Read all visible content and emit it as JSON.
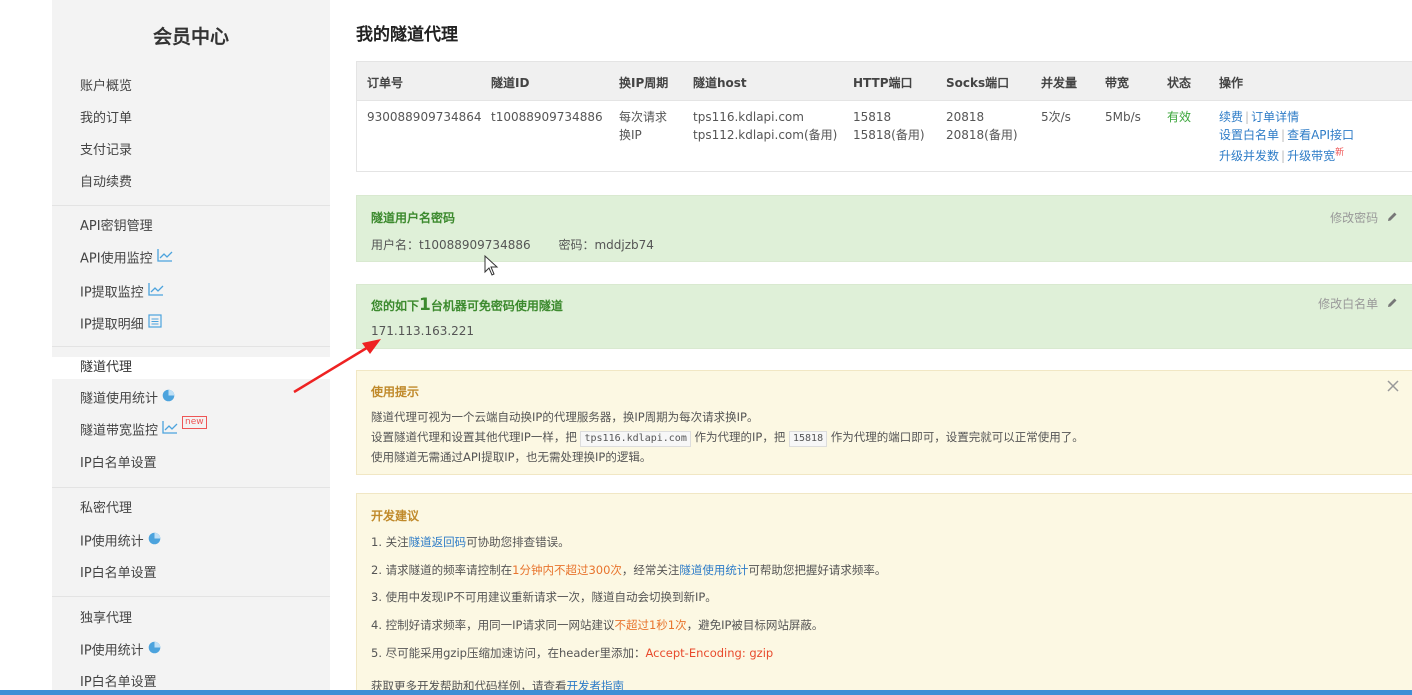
{
  "sidebar": {
    "title": "会员中心",
    "groups": [
      {
        "items": [
          {
            "label": "账户概览"
          },
          {
            "label": "我的订单"
          },
          {
            "label": "支付记录"
          },
          {
            "label": "自动续费"
          }
        ]
      },
      {
        "items": [
          {
            "label": "API密钥管理"
          },
          {
            "label": "API使用监控",
            "icon": "line-chart-icon"
          },
          {
            "label": "IP提取监控",
            "icon": "line-chart-icon"
          },
          {
            "label": "IP提取明细",
            "icon": "document-icon"
          }
        ]
      },
      {
        "items": [
          {
            "label": "隧道代理",
            "active": true
          },
          {
            "label": "隧道使用统计",
            "icon": "pie-chart-icon"
          },
          {
            "label": "隧道带宽监控",
            "icon": "line-chart-icon",
            "badge": "new"
          },
          {
            "label": "IP白名单设置"
          }
        ]
      },
      {
        "items": [
          {
            "label": "私密代理"
          },
          {
            "label": "IP使用统计",
            "icon": "pie-chart-icon"
          },
          {
            "label": "IP白名单设置"
          }
        ]
      },
      {
        "items": [
          {
            "label": "独享代理"
          },
          {
            "label": "IP使用统计",
            "icon": "pie-chart-icon"
          },
          {
            "label": "IP白名单设置"
          }
        ]
      }
    ]
  },
  "main": {
    "title": "我的隧道代理",
    "table": {
      "headers": [
        "订单号",
        "隧道ID",
        "换IP周期",
        "隧道host",
        "HTTP端口",
        "Socks端口",
        "并发量",
        "带宽",
        "状态",
        "操作"
      ],
      "row": {
        "order": "930088909734864",
        "tunnel_id": "t10088909734886",
        "cycle_line1": "每次请求",
        "cycle_line2": "换IP",
        "host": "tps116.kdlapi.com",
        "host_backup": "tps112.kdlapi.com(备用)",
        "http_port": "15818",
        "http_port_backup": "15818(备用)",
        "socks_port": "20818",
        "socks_port_backup": "20818(备用)",
        "concurrency": "5次/s",
        "bandwidth": "5Mb/s",
        "status": "有效",
        "actions": {
          "renew": "续费",
          "order_detail": "订单详情",
          "set_whitelist": "设置白名单",
          "view_api": "查看API接口",
          "upgrade_concurrency": "升级并发数",
          "upgrade_bandwidth": "升级带宽",
          "new_mark": "新"
        }
      }
    },
    "credentials": {
      "title": "隧道用户名密码",
      "username_label": "用户名：",
      "username": "t10088909734886",
      "password_label": "密码：",
      "password": "mddjzb74",
      "edit_label": "修改密码"
    },
    "whitelist": {
      "title_prefix": "您的如下",
      "count": "1",
      "title_suffix": "台机器可免密码使用隧道",
      "ip": "171.113.163.221",
      "edit_label": "修改白名单"
    },
    "tips": {
      "title": "使用提示",
      "line1": "隧道代理可视为一个云端自动换IP的代理服务器，换IP周期为每次请求换IP。",
      "line2_a": "设置隧道代理和设置其他代理IP一样，把",
      "line2_code1": "tps116.kdlapi.com",
      "line2_b": "作为代理的IP，把",
      "line2_code2": "15818",
      "line2_c": "作为代理的端口即可，设置完就可以正常使用了。",
      "line3": "使用隧道无需通过API提取IP，也无需处理换IP的逻辑。"
    },
    "dev": {
      "title": "开发建议",
      "l1_a": "1. 关注",
      "l1_link": "隧道返回码",
      "l1_b": "可协助您排查错误。",
      "l2_a": "2. 请求隧道的频率请控制在",
      "l2_hl": "1分钟内不超过300次",
      "l2_b": "，经常关注",
      "l2_link": "隧道使用统计",
      "l2_c": "可帮助您把握好请求频率。",
      "l3": "3. 使用中发现IP不可用建议重新请求一次，隧道自动会切换到新IP。",
      "l4_a": "4. 控制好请求频率，用同一IP请求同一网站建议",
      "l4_hl": "不超过1秒1次",
      "l4_b": "，避免IP被目标网站屏蔽。",
      "l5_a": "5. 尽可能采用gzip压缩加速访问，在header里添加：",
      "l5_hl": "Accept-Encoding: gzip",
      "l6_a": "获取更多开发帮助和代码样例，请查看",
      "l6_link": "开发者指南"
    }
  },
  "colors": {
    "green_panel": "#dff0d8",
    "yellow_panel": "#fcf8e3",
    "link": "#2e7cc7",
    "status_ok": "#3aa53a",
    "highlight": "#e8742d",
    "arrow": "#ee2222"
  }
}
